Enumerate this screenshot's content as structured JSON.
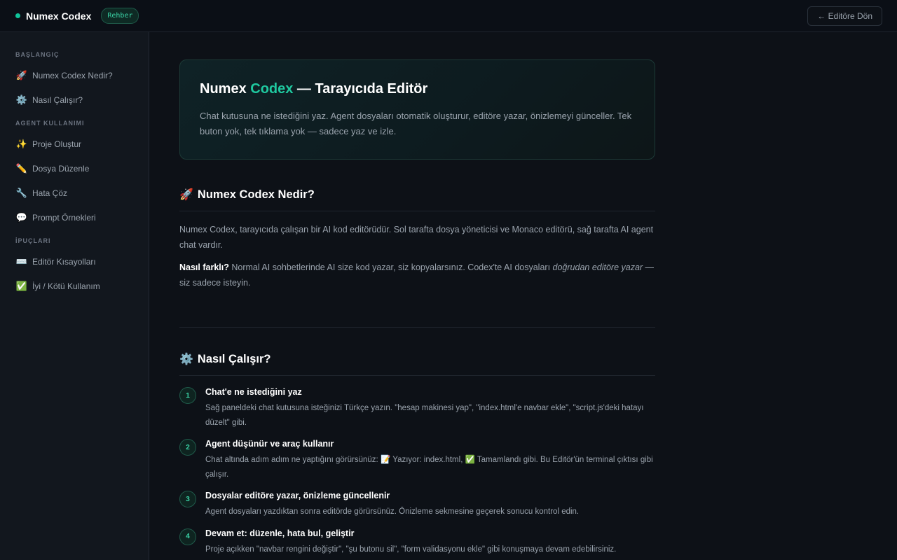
{
  "header": {
    "brand": "Numex Codex",
    "badge": "Rehber",
    "back_label": "← Editöre Dön"
  },
  "sidebar": {
    "sections": [
      {
        "title": "BAŞLANGIÇ",
        "items": [
          {
            "icon": "🚀",
            "label": "Numex Codex Nedir?"
          },
          {
            "icon": "⚙️",
            "label": "Nasıl Çalışır?"
          }
        ]
      },
      {
        "title": "AGENT KULLANIMI",
        "items": [
          {
            "icon": "✨",
            "label": "Proje Oluştur"
          },
          {
            "icon": "✏️",
            "label": "Dosya Düzenle"
          },
          {
            "icon": "🔧",
            "label": "Hata Çöz"
          },
          {
            "icon": "💬",
            "label": "Prompt Örnekleri"
          }
        ]
      },
      {
        "title": "İPUÇLARI",
        "items": [
          {
            "icon": "⌨️",
            "label": "Editör Kısayolları"
          },
          {
            "icon": "✅",
            "label": "İyi / Kötü Kullanım"
          }
        ]
      }
    ]
  },
  "hero": {
    "title_prefix": "Numex ",
    "title_accent": "Codex",
    "title_suffix": " — Tarayıcıda Editör",
    "text": "Chat kutusuna ne istediğini yaz. Agent dosyaları otomatik oluşturur, editöre yazar, önizlemeyi günceller. Tek buton yok, tek tıklama yok — sadece yaz ve izle."
  },
  "section1": {
    "icon": "🚀",
    "title": "Numex Codex Nedir?",
    "p1": "Numex Codex, tarayıcıda çalışan bir AI kod editörüdür. Sol tarafta dosya yöneticisi ve Monaco editörü, sağ tarafta AI agent chat vardır.",
    "p2_bold": "Nasıl farklı?",
    "p2_text": " Normal AI sohbetlerinde AI size kod yazar, siz kopyalarsınız. Codex'te AI dosyaları ",
    "p2_italic": "doğrudan editöre yazar",
    "p2_end": " — siz sadece isteyin."
  },
  "section2": {
    "icon": "⚙️",
    "title": "Nasıl Çalışır?",
    "steps": [
      {
        "num": "1",
        "title": "Chat'e ne istediğini yaz",
        "desc": "Sağ paneldeki chat kutusuna isteğinizi Türkçe yazın. \"hesap makinesi yap\", \"index.html'e navbar ekle\", \"script.js'deki hatayı düzelt\" gibi."
      },
      {
        "num": "2",
        "title": "Agent düşünür ve araç kullanır",
        "desc": "Chat altında adım adım ne yaptığını görürsünüz: 📝 Yazıyor: index.html, ✅ Tamamlandı gibi. Bu Editör'ün terminal çıktısı gibi çalışır."
      },
      {
        "num": "3",
        "title": "Dosyalar editöre yazar, önizleme güncellenir",
        "desc": "Agent dosyaları yazdıktan sonra editörde görürsünüz. Önizleme sekmesine geçerek sonucu kontrol edin."
      },
      {
        "num": "4",
        "title": "Devam et: düzenle, hata bul, geliştir",
        "desc": "Proje açıkken \"navbar rengini değiştir\", \"şu butonu sil\", \"form validasyonu ekle\" gibi konuşmaya devam edebilirsiniz."
      }
    ]
  }
}
